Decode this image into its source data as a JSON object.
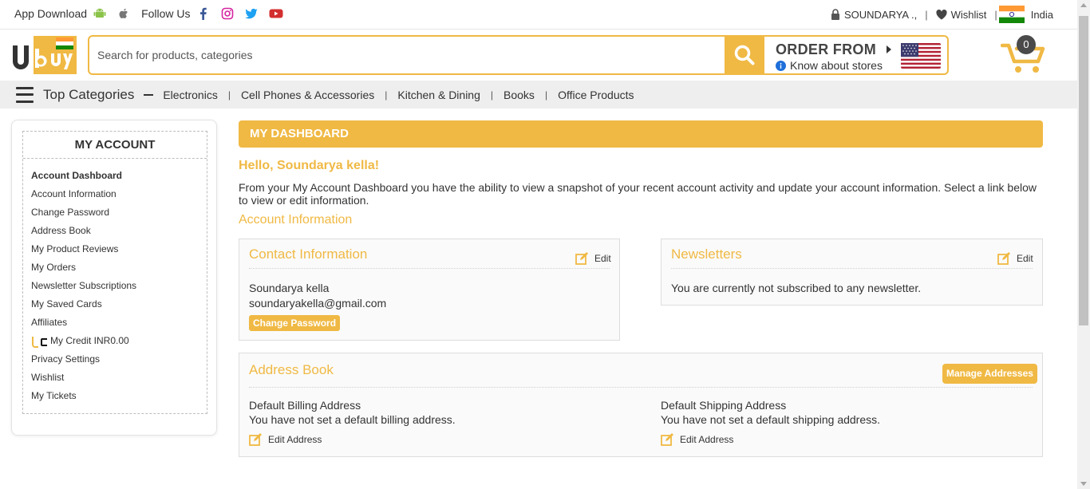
{
  "topbar": {
    "app_download": "App Download",
    "follow_us": "Follow Us",
    "user": "SOUNDARYA .,",
    "sep": "|",
    "wishlist": "Wishlist",
    "country": "India"
  },
  "header": {
    "search_placeholder": "Search for products, categories",
    "order_from": "ORDER FROM",
    "know_stores": "Know about stores",
    "cart_count": "0"
  },
  "categories": {
    "title": "Top Categories",
    "items": [
      "Electronics",
      "Cell Phones & Accessories",
      "Kitchen & Dining",
      "Books",
      "Office Products"
    ],
    "sep": "|"
  },
  "sidebar": {
    "heading": "MY ACCOUNT",
    "items": [
      "Account Dashboard",
      "Account Information",
      "Change Password",
      "Address Book",
      "My Product Reviews",
      "My Orders",
      "Newsletter Subscriptions",
      "My Saved Cards",
      "Affiliates",
      "My Credit INR0.00",
      "Privacy Settings",
      "Wishlist",
      "My Tickets"
    ]
  },
  "dashboard": {
    "title": "MY DASHBOARD",
    "hello": "Hello, Soundarya kella!",
    "intro": "From your My Account Dashboard you have the ability to view a snapshot of your recent account activity and update your account information. Select a link below to view or edit information.",
    "account_info_title": "Account Information"
  },
  "contact": {
    "title": "Contact Information",
    "edit": "Edit",
    "name": "Soundarya kella",
    "email": "soundaryakella@gmail.com",
    "change_password": "Change Password"
  },
  "newsletters": {
    "title": "Newsletters",
    "edit": "Edit",
    "status": "You are currently not subscribed to any newsletter."
  },
  "address_book": {
    "title": "Address Book",
    "manage": "Manage Addresses",
    "billing_title": "Default Billing Address",
    "billing_text": "You have not set a default billing address.",
    "billing_edit": "Edit Address",
    "shipping_title": "Default Shipping Address",
    "shipping_text": "You have not set a default shipping address.",
    "shipping_edit": "Edit Address"
  },
  "colors": {
    "accent": "#f0b944",
    "text": "#333333",
    "bar_bg": "#eeeeee"
  }
}
